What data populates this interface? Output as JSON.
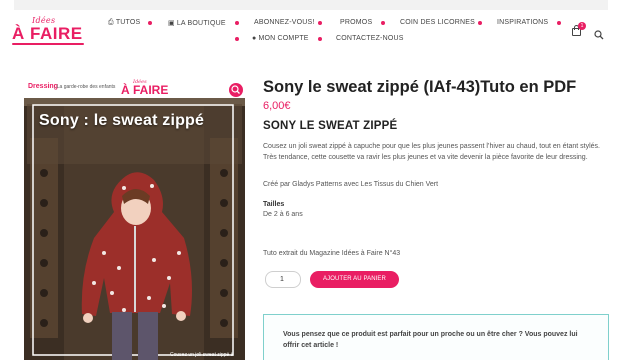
{
  "logo": {
    "line1": "Idées",
    "line2": "À FAIRE"
  },
  "nav": {
    "row1": [
      {
        "icon": "printer-icon",
        "glyph": "⎙",
        "label": "TUTOS"
      },
      {
        "icon": "basket-icon",
        "glyph": "🧺",
        "label": "LA BOUTIQUE"
      },
      {
        "label": "ABONNEZ-VOUS!"
      },
      {
        "label": "PROMOS"
      },
      {
        "label": "COIN DES LICORNES"
      },
      {
        "label": "INSPIRATIONS"
      }
    ],
    "row2": [
      {
        "icon": "user-icon",
        "glyph": "👤",
        "label": "MON COMPTE"
      },
      {
        "label": "CONTACTEZ-NOUS"
      }
    ]
  },
  "cart": {
    "count": "1"
  },
  "product_image": {
    "magazine_name": "Dressing",
    "magazine_sub": ", La garde-robe des enfants",
    "logo_line1": "Idées",
    "logo_line2": "À FAIRE",
    "cover_title": "Sony : le sweat zippé",
    "caption": "Cousez un joli sweat zippé à"
  },
  "product": {
    "title": "Sony le sweat zippé (IAf-43)Tuto en PDF",
    "price": "6,00€",
    "subheading": "SONY LE SWEAT ZIPPÉ",
    "description": "Cousez un joli sweat zippé à capuche pour que les plus jeunes passent l’hiver au chaud, tout en étant stylés. Très tendance, cette cousette va ravir les plus jeunes et va vite devenir la pièce favorite de leur dressing.",
    "credit": "Créé par Gladys Patterns avec Les Tissus du Chien Vert",
    "sizes_heading": "Tailles",
    "sizes_value": "De 2 à 6 ans",
    "extract_note": "Tuto extrait du Magazine Idées à Faire N°43",
    "quantity": "1",
    "add_to_cart_label": "AJOUTER AU PANIER"
  },
  "notice": {
    "line1": "Vous pensez que ce produit est parfait pour un proche ou un être cher ? Vous pouvez lui",
    "line2": "offrir cet article !"
  },
  "colors": {
    "accent": "#e91e63",
    "notice_border": "#7fd0cc",
    "hoodie": "#9c2f2a"
  }
}
